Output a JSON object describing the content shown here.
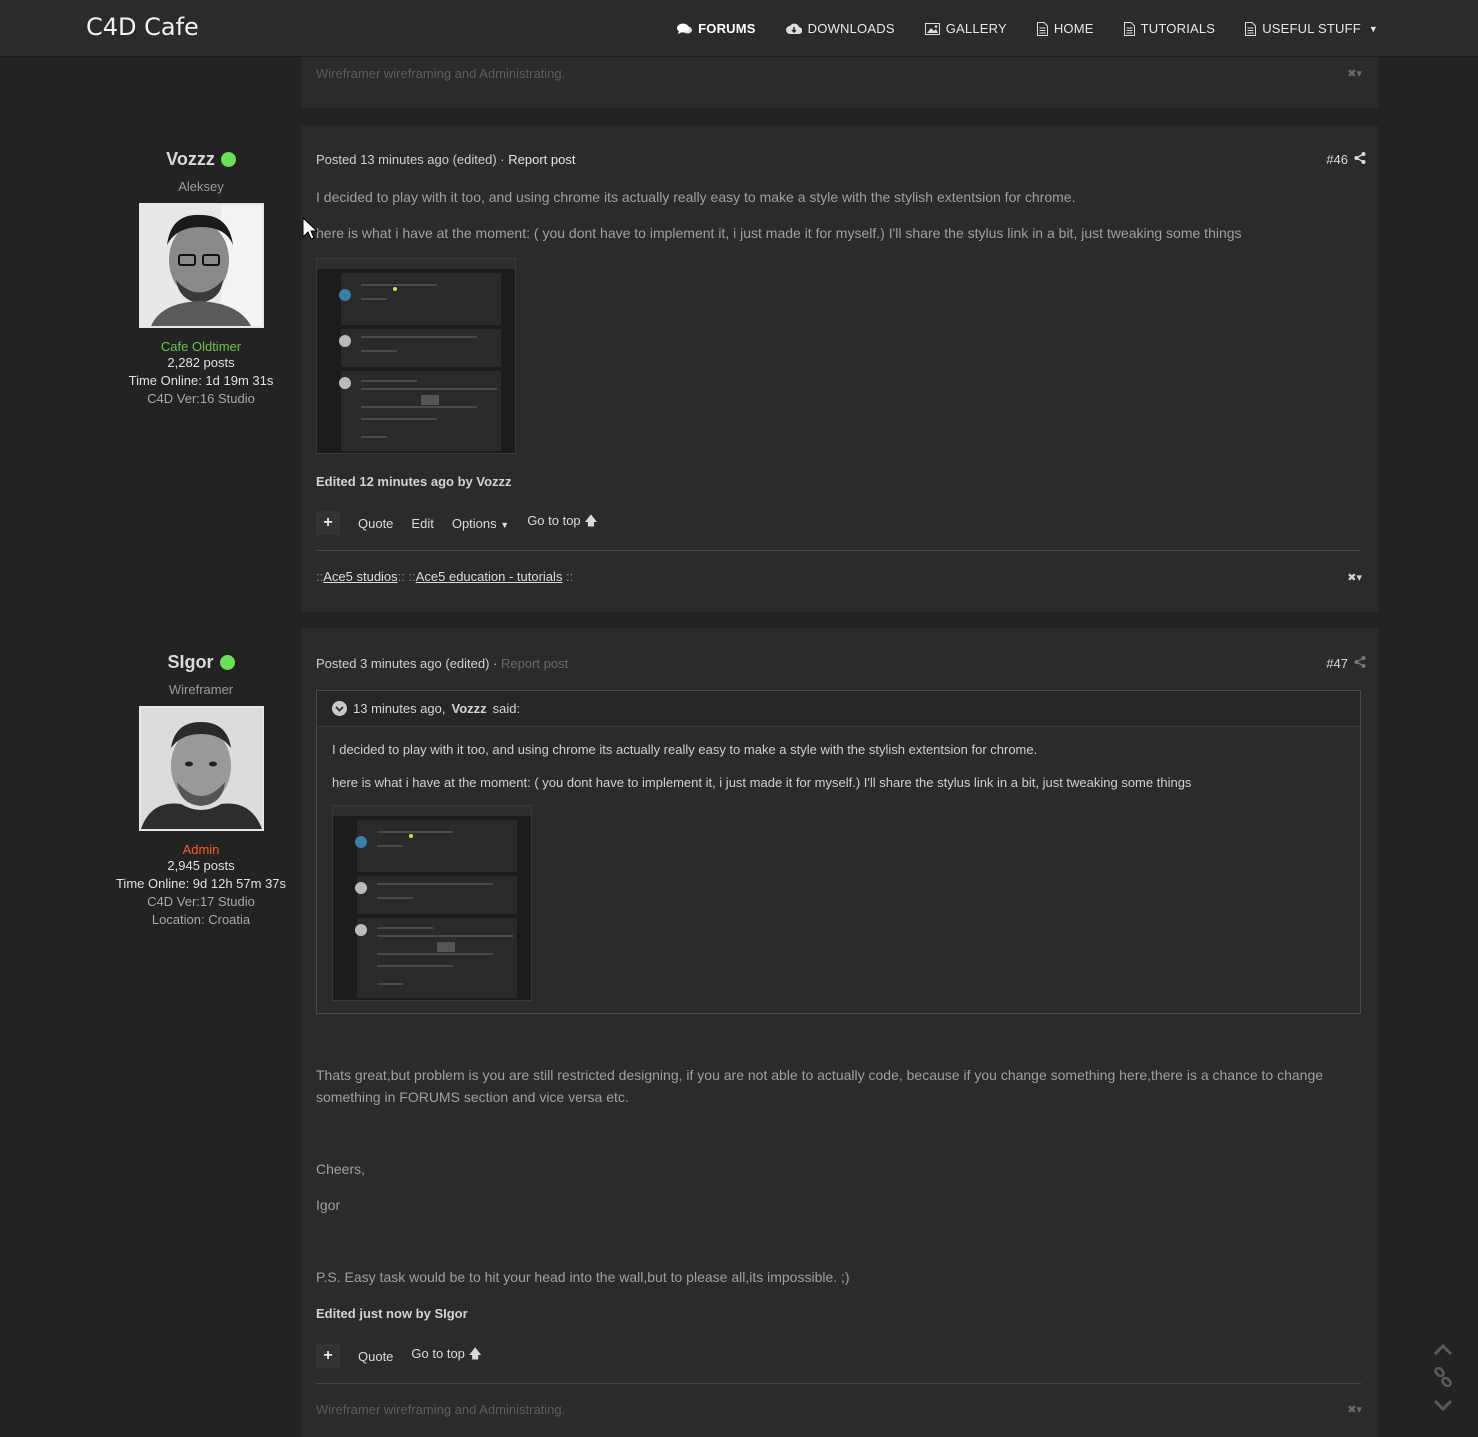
{
  "nav": {
    "brand": "C4D Cafe",
    "items": [
      {
        "label": "FORUMS",
        "icon": "comments-icon",
        "active": true
      },
      {
        "label": "DOWNLOADS",
        "icon": "cloud-download-icon",
        "active": false
      },
      {
        "label": "GALLERY",
        "icon": "image-icon",
        "active": false
      },
      {
        "label": "HOME",
        "icon": "document-icon",
        "active": false
      },
      {
        "label": "TUTORIALS",
        "icon": "document-icon",
        "active": false
      },
      {
        "label": "USEFUL STUFF",
        "icon": "document-icon",
        "active": false,
        "dropdown": true
      }
    ]
  },
  "top_signature": "Wireframer wireframing and Administrating.",
  "posts": [
    {
      "author": {
        "name": "Vozzz",
        "subtitle": "Aleksey",
        "rank": "Cafe Oldtimer",
        "rank_color": "#6cc24a",
        "posts": "2,282 posts",
        "time_online": "Time Online: 1d 19m 31s",
        "version": "C4D Ver:16 Studio"
      },
      "meta_prefix": "Posted 13 minutes ago (edited)",
      "meta_sep": " · ",
      "report": "Report post",
      "number": "#46",
      "paragraphs": [
        "I decided to play with it too, and using chrome its actually really easy to make a style with the stylish extentsion for chrome.",
        "here is what i have at the moment: ( you dont have to implement it, i just made it for myself.) I'll share the stylus link in a bit, just tweaking some things"
      ],
      "edited": "Edited 12 minutes ago by Vozzz",
      "actions": {
        "quote": "Quote",
        "edit": "Edit",
        "options": "Options",
        "go_top": "Go to top"
      },
      "signature": {
        "prefix": "::",
        "link1": "Ace5 studios",
        "mid": ":: ::",
        "link2": "Ace5 education - tutorials",
        "suffix": " ::"
      }
    },
    {
      "author": {
        "name": "SIgor",
        "subtitle": "Wireframer",
        "rank": "Admin",
        "rank_color": "#ff5a2b",
        "posts": "2,945 posts",
        "time_online": "Time Online: 9d 12h 57m 37s",
        "version": "C4D Ver:17 Studio",
        "location": "Location: Croatia"
      },
      "meta_prefix": "Posted 3 minutes ago (edited)",
      "meta_sep": " · ",
      "report": "Report post",
      "number": "#47",
      "quote": {
        "head_time": "13 minutes ago,",
        "head_author": "Vozzz",
        "head_said": "said:",
        "paragraphs": [
          "I decided to play with it too, and using chrome its actually really easy to make a style with the stylish extentsion for chrome.",
          "here is what i have at the moment: ( you dont have to implement it, i just made it for myself.) I'll share the stylus link in a bit, just tweaking some things"
        ]
      },
      "body": [
        "Thats great,but problem is you are still restricted designing, if you are not able to actually code, because if you change something here,there is a chance to change",
        "something in FORUMS section and vice versa etc.",
        "Cheers,",
        "Igor",
        "P.S. Easy task would be to hit your head into the wall,but to please all,its impossible. ;)"
      ],
      "edited": "Edited just now by SIgor",
      "actions": {
        "quote": "Quote",
        "go_top": "Go to top"
      },
      "signature": "Wireframer wireframing and Administrating."
    }
  ]
}
